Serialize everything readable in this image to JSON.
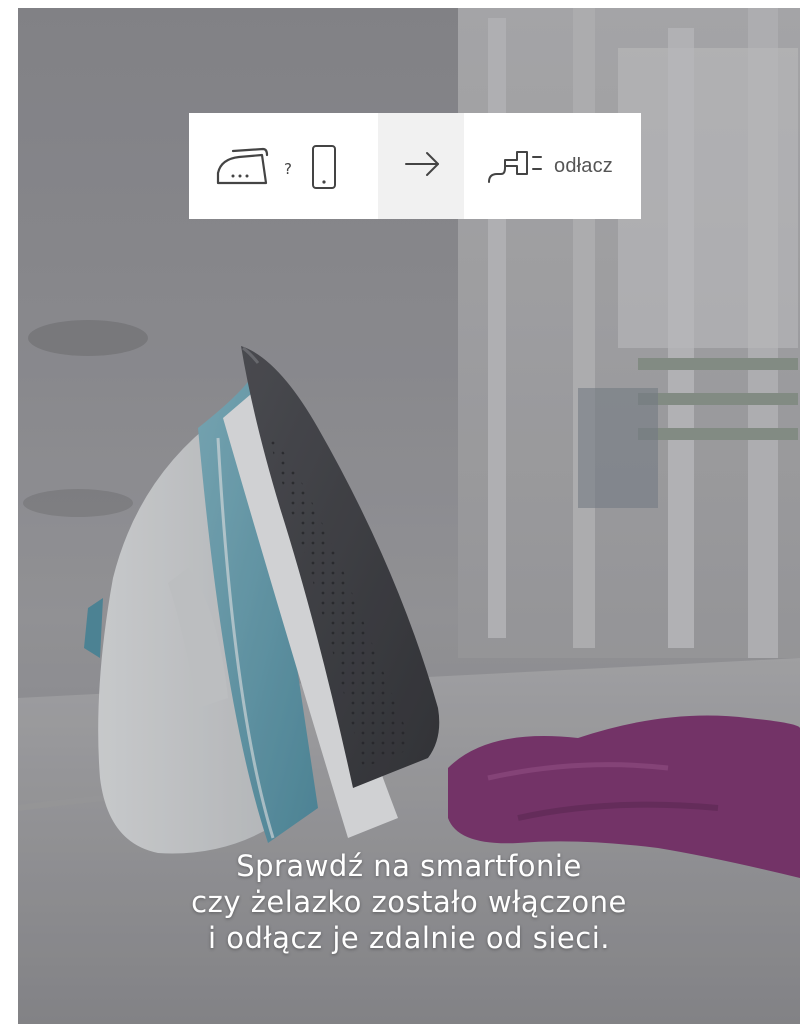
{
  "icon_strip": {
    "iron_icon": "iron-icon",
    "question_mark": "?",
    "phone_icon": "smartphone-icon",
    "arrow_icon": "arrow-right-icon",
    "plug_icon": "plug-icon",
    "action_label": "odłacz"
  },
  "caption": {
    "line1": "Sprawdź na smartfonie",
    "line2": "czy żelazko zostało włączone",
    "line3": "i odłącz je zdalnie od sieci."
  },
  "colors": {
    "iron_accent": "#6aa7b7",
    "cloth": "#7d2f6d",
    "caption_text": "#ffffff",
    "icon_stroke": "#444444"
  }
}
